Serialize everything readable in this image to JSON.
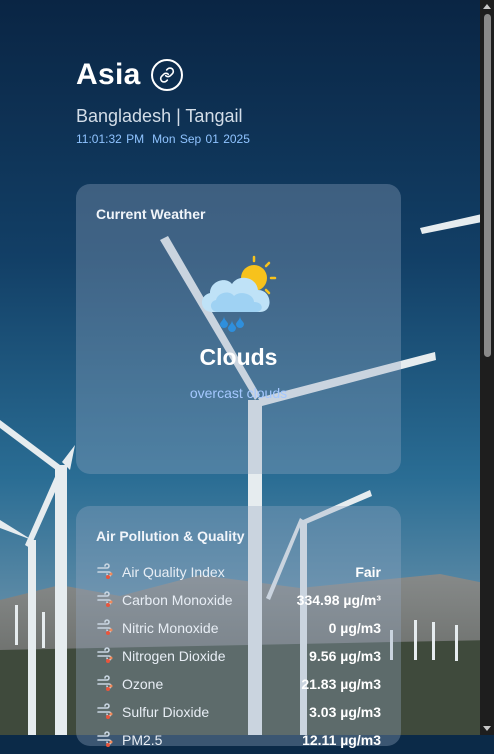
{
  "header": {
    "title": "Asia",
    "location": "Bangladesh | Tangail",
    "time": "11:01:32 PM",
    "date": "Mon Sep 01 2025"
  },
  "current_weather": {
    "title": "Current Weather",
    "icon": "cloud-sun-rain-icon",
    "condition": "Clouds",
    "description": "overcast clouds"
  },
  "air_quality": {
    "title": "Air Pollution & Quality",
    "items": [
      {
        "label": "Air Quality Index",
        "value": "Fair"
      },
      {
        "label": "Carbon Monoxide",
        "value": "334.98 µg/m³"
      },
      {
        "label": "Nitric Monoxide",
        "value": "0 µg/m3"
      },
      {
        "label": "Nitrogen Dioxide",
        "value": "9.56 µg/m3"
      },
      {
        "label": "Ozone",
        "value": "21.83 µg/m3"
      },
      {
        "label": "Sulfur Dioxide",
        "value": "3.03 µg/m3"
      },
      {
        "label": "PM2.5",
        "value": "12.11 µg/m3"
      }
    ]
  },
  "colors": {
    "accent": "#8fc3ff",
    "description": "#a5c8ff",
    "card_bg": "#96aac3"
  }
}
